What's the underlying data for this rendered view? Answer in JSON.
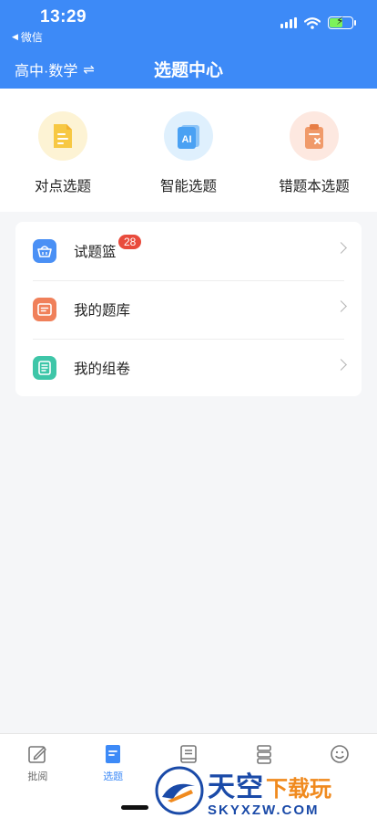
{
  "status_bar": {
    "time": "13:29",
    "back_app": "微信",
    "back_arrow": "◀"
  },
  "nav": {
    "subject": "高中·数学",
    "switch_glyph": "⇌",
    "title": "选题中心"
  },
  "quick_actions": [
    {
      "label": "对点选题",
      "icon": "document-icon"
    },
    {
      "label": "智能选题",
      "icon": "ai-icon",
      "icon_text": "AI"
    },
    {
      "label": "错题本选题",
      "icon": "clipboard-x-icon"
    }
  ],
  "list": [
    {
      "label": "试题篮",
      "badge": "28",
      "icon": "basket-icon"
    },
    {
      "label": "我的题库",
      "icon": "folder-icon"
    },
    {
      "label": "我的组卷",
      "icon": "paper-list-icon"
    }
  ],
  "tabs": [
    {
      "label": "批阅",
      "icon": "edit-icon",
      "active": false
    },
    {
      "label": "选题",
      "icon": "select-doc-icon",
      "active": true
    },
    {
      "label": "",
      "icon": "book-icon",
      "active": false
    },
    {
      "label": "",
      "icon": "stack-icon",
      "active": false
    },
    {
      "label": "",
      "icon": "smile-icon",
      "active": false
    }
  ],
  "watermark": {
    "cn_main": "天空",
    "cn_sub": "下载玩",
    "en": "SKYXZW.COM"
  },
  "colors": {
    "primary": "#3d8af7",
    "badge": "#e94b3c",
    "background": "#f5f6f8"
  }
}
